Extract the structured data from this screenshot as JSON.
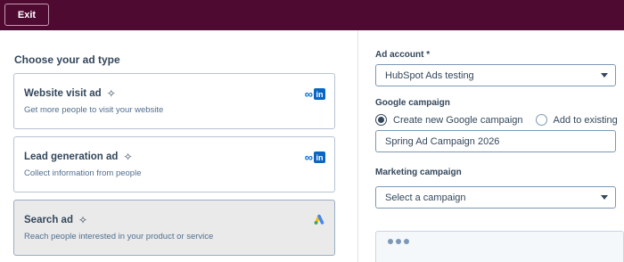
{
  "header": {
    "exit_label": "Exit"
  },
  "left": {
    "title": "Choose your ad type",
    "cards": [
      {
        "title": "Website visit ad",
        "desc": "Get more people to visit your website",
        "brands": "meta-linkedin",
        "selected": false
      },
      {
        "title": "Lead generation ad",
        "desc": "Collect information from people",
        "brands": "meta-linkedin",
        "selected": false
      },
      {
        "title": "Search ad",
        "desc": "Reach people interested in your product or service",
        "brands": "google-ads",
        "selected": true
      }
    ]
  },
  "right": {
    "ad_account_label": "Ad account *",
    "ad_account_value": "HubSpot Ads testing",
    "google_campaign_label": "Google campaign",
    "radio_new_label": "Create new Google campaign",
    "radio_existing_label": "Add to existing",
    "radio_selected": "new",
    "campaign_name_value": "Spring Ad Campaign 2026",
    "marketing_campaign_label": "Marketing campaign",
    "marketing_campaign_placeholder": "Select a campaign"
  },
  "icons": {
    "sparkle": "✧",
    "meta_logo": "∞",
    "linkedin_logo": "in"
  },
  "colors": {
    "header_bg": "#4f0a32",
    "linkedin": "#0a66c2",
    "meta": "#0668e1",
    "selected_card_bg": "#eaeaea"
  }
}
